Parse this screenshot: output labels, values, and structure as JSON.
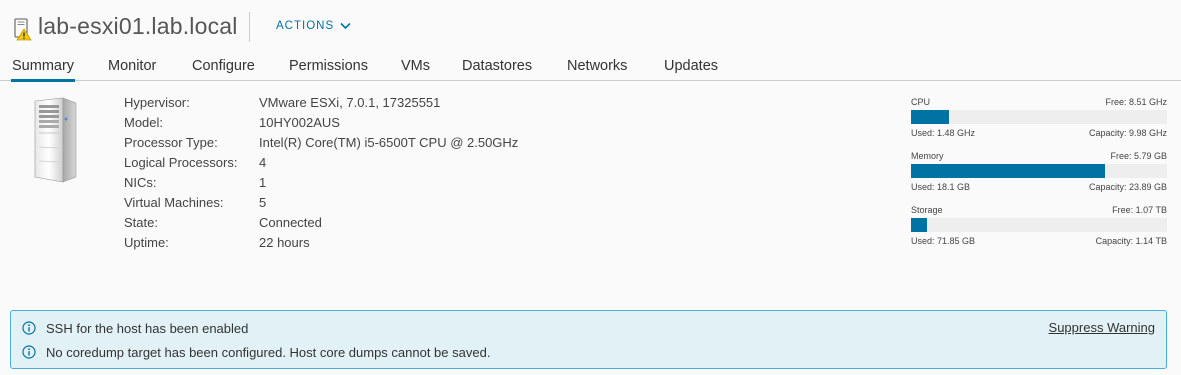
{
  "header": {
    "host_name": "lab-esxi01.lab.local",
    "actions_label": "ACTIONS"
  },
  "tabs": [
    {
      "label": "Summary",
      "active": true
    },
    {
      "label": "Monitor"
    },
    {
      "label": "Configure"
    },
    {
      "label": "Permissions"
    },
    {
      "label": "VMs"
    },
    {
      "label": "Datastores"
    },
    {
      "label": "Networks"
    },
    {
      "label": "Updates"
    }
  ],
  "info": [
    {
      "label": "Hypervisor:",
      "value": "VMware ESXi, 7.0.1, 17325551"
    },
    {
      "label": "Model:",
      "value": "10HY002AUS"
    },
    {
      "label": "Processor Type:",
      "value": "Intel(R) Core(TM) i5-6500T CPU @ 2.50GHz"
    },
    {
      "label": "Logical Processors:",
      "value": "4"
    },
    {
      "label": "NICs:",
      "value": "1"
    },
    {
      "label": "Virtual Machines:",
      "value": "5"
    },
    {
      "label": "State:",
      "value": "Connected"
    },
    {
      "label": "Uptime:",
      "value": "22 hours"
    }
  ],
  "resources": [
    {
      "name": "CPU",
      "free": "Free: 8.51 GHz",
      "used": "Used: 1.48 GHz",
      "capacity": "Capacity: 9.98 GHz",
      "fraction": 0.148
    },
    {
      "name": "Memory",
      "free": "Free: 5.79 GB",
      "used": "Used: 18.1 GB",
      "capacity": "Capacity: 23.89 GB",
      "fraction": 0.758
    },
    {
      "name": "Storage",
      "free": "Free: 1.07 TB",
      "used": "Used: 71.85 GB",
      "capacity": "Capacity: 1.14 TB",
      "fraction": 0.062
    }
  ],
  "alerts": {
    "messages": [
      "SSH for the host has been enabled",
      "No coredump target has been configured. Host core dumps cannot be saved."
    ],
    "suppress_label": "Suppress Warning"
  },
  "colors": {
    "accent": "#0072a3",
    "alert_bg": "#e1f1f6",
    "alert_border": "#49afd9",
    "warning": "#f2c80f"
  }
}
